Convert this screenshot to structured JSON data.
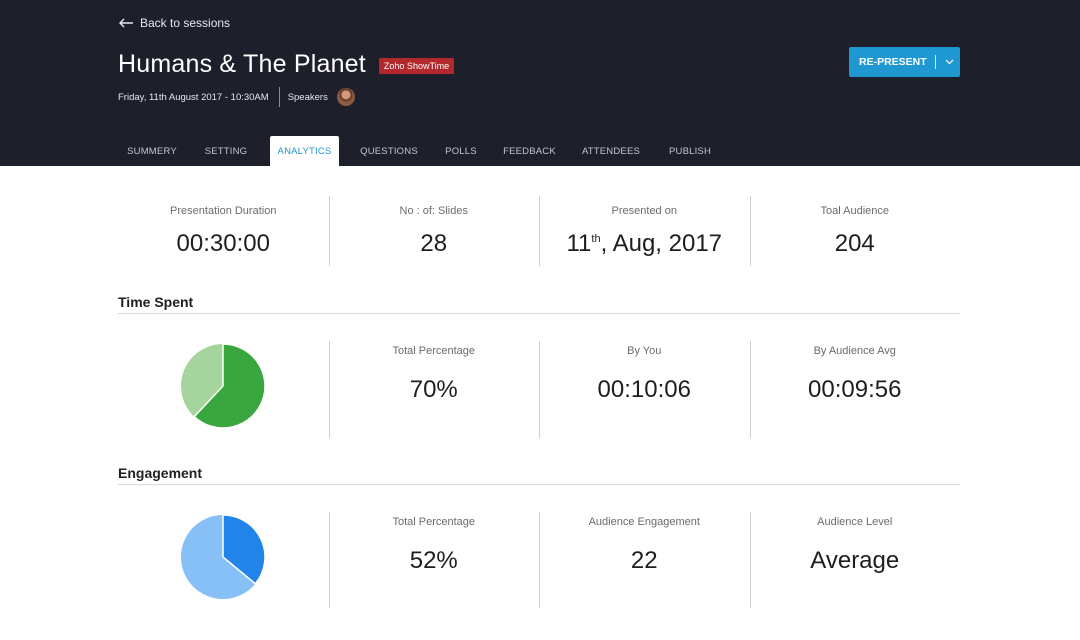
{
  "header": {
    "back_label": "Back to sessions",
    "title": "Humans & The Planet",
    "badge": "Zoho ShowTime",
    "date": "Friday, 11th August 2017 - 10:30AM",
    "speakers_label": "Speakers",
    "represent_label": "RE-PRESENT",
    "background_color": "#1d1f2b",
    "accent_color": "#1f98d2",
    "badge_color": "#b3282d"
  },
  "tabs": [
    {
      "label": "SUMMERY",
      "active": false
    },
    {
      "label": "SETTING",
      "active": false
    },
    {
      "label": "ANALYTICS",
      "active": true
    },
    {
      "label": "QUESTIONS",
      "active": false
    },
    {
      "label": "POLLS",
      "active": false
    },
    {
      "label": "FEEDBACK",
      "active": false
    },
    {
      "label": "ATTENDEES",
      "active": false
    },
    {
      "label": "PUBLISH",
      "active": false
    }
  ],
  "overview": [
    {
      "label": "Presentation Duration",
      "value": "00:30:00"
    },
    {
      "label": "No : of: Slides",
      "value": "28"
    },
    {
      "label": "Presented on",
      "value_prefix": "11",
      "value_sup": "th",
      "value_suffix": ", Aug, 2017"
    },
    {
      "label": "Toal Audience",
      "value": "204"
    }
  ],
  "time_spent": {
    "title": "Time Spent",
    "pie": {
      "percent": 62,
      "color_main": "#3aa63f",
      "color_rest": "#a5d59c"
    },
    "stats": [
      {
        "label": "Total Percentage",
        "value": "70%"
      },
      {
        "label": "By You",
        "value": "00:10:06"
      },
      {
        "label": "By Audience Avg",
        "value": "00:09:56"
      }
    ]
  },
  "engagement": {
    "title": "Engagement",
    "pie": {
      "percent": 36,
      "color_main": "#2084e8",
      "color_rest": "#86c0f7"
    },
    "stats": [
      {
        "label": "Total Percentage",
        "value": "52%"
      },
      {
        "label": "Audience Engagement",
        "value": "22"
      },
      {
        "label": "Audience Level",
        "value": "Average"
      }
    ]
  }
}
